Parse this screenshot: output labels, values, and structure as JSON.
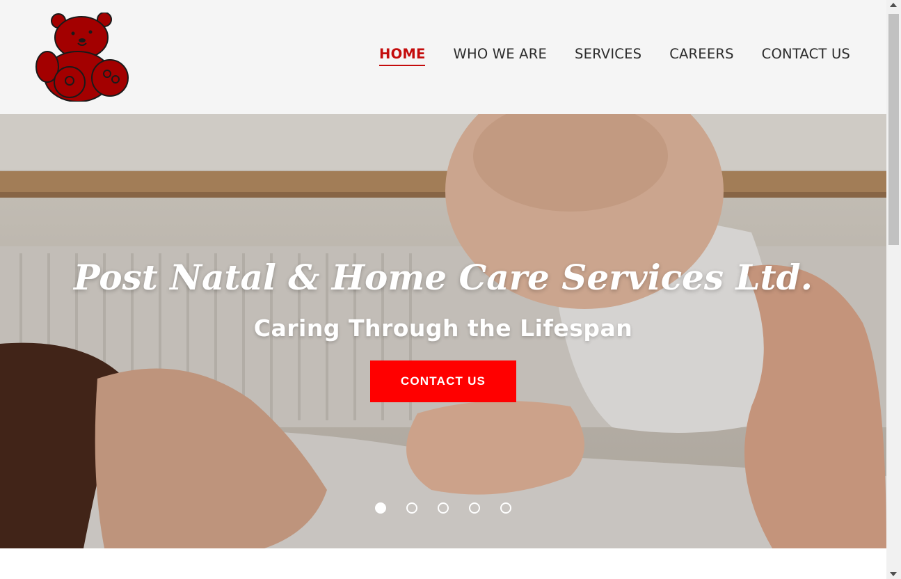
{
  "nav": {
    "items": [
      {
        "label": "HOME",
        "active": true
      },
      {
        "label": "WHO WE ARE",
        "active": false
      },
      {
        "label": "SERVICES",
        "active": false
      },
      {
        "label": "CAREERS",
        "active": false
      },
      {
        "label": "CONTACT US",
        "active": false
      }
    ]
  },
  "logo": {
    "icon": "teddy-bear-icon",
    "color": "#a30000"
  },
  "hero": {
    "title": "Post Natal & Home Care Services Ltd.",
    "subtitle": "Caring Through the Lifespan",
    "cta_label": "CONTACT US",
    "slide_count": 5,
    "active_slide": 1
  },
  "colors": {
    "accent": "#c40c0c",
    "button": "#ff0000",
    "header_bg": "#f5f5f5"
  }
}
